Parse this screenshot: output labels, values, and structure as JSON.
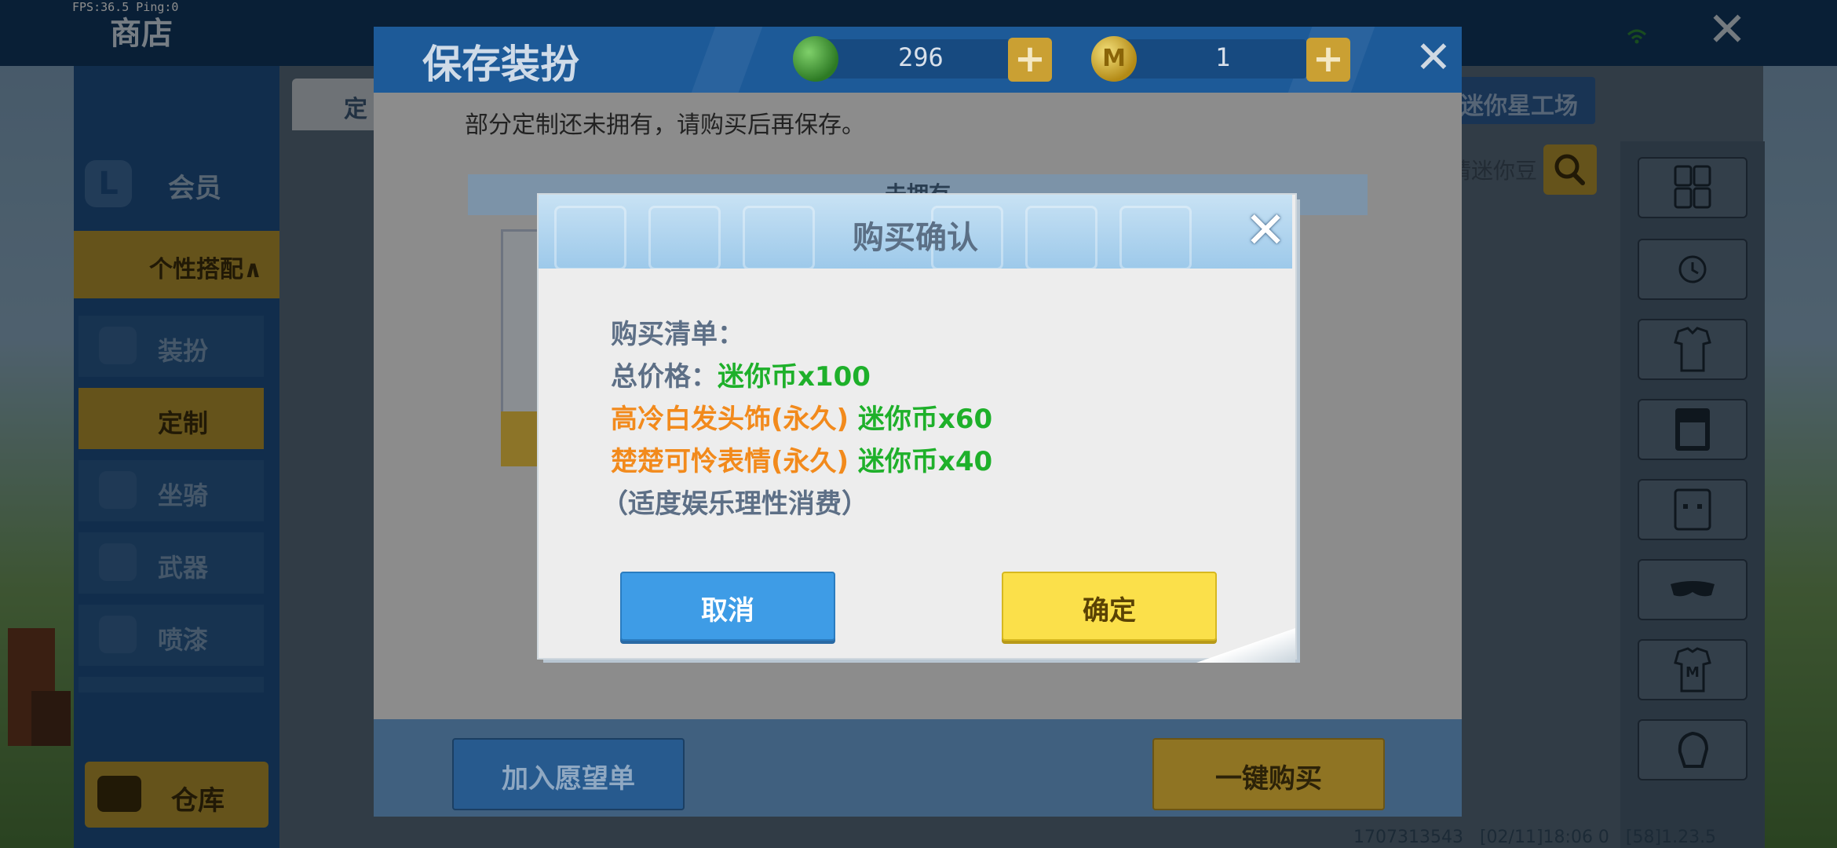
{
  "debug": {
    "fps_text": "FPS:36.5  Ping:0"
  },
  "shop": {
    "title": "商店",
    "close_glyph": "✕",
    "tab_left": "定",
    "tab_right": "迷你星工场",
    "search_hint": "请迷你豆"
  },
  "sidebar": {
    "vip": "会员",
    "group": "个性搭配∧",
    "items": [
      {
        "label": "装扮",
        "active": false
      },
      {
        "label": "定制",
        "active": true
      },
      {
        "label": "坐骑",
        "active": false
      },
      {
        "label": "武器",
        "active": false
      },
      {
        "label": "喷漆",
        "active": false
      }
    ],
    "warehouse": "仓库"
  },
  "save_dialog": {
    "title": "保存装扮",
    "gem_count": "296",
    "coin_count": "1",
    "plus_glyph": "+",
    "coin_glyph": "M",
    "close_glyph": "✕",
    "message": "部分定制还未拥有，请购买后再保存。",
    "unowned_header": "未拥有",
    "wishlist_button": "加入愿望单",
    "buy_all_button": "一键购买"
  },
  "confirm_dialog": {
    "title": "购买确认",
    "close_glyph": "✕",
    "list_label": "购买清单：",
    "total_label": "总价格：",
    "total_value": "迷你币x100",
    "items": [
      {
        "name": "高冷白发头饰(永久)",
        "price": "迷你币x60"
      },
      {
        "name": "楚楚可怜表情(永久)",
        "price": "迷你币x40"
      }
    ],
    "notice": "（适度娱乐理性消费）",
    "cancel_button": "取消",
    "ok_button": "确定"
  },
  "right_panel": {
    "icons": [
      "grid-icon",
      "history-icon",
      "outfit-icon",
      "hair-icon",
      "face-icon",
      "mask-icon",
      "m-shirt-icon",
      "glove-icon"
    ]
  },
  "status": {
    "uid": "1707313543",
    "datetime": "[02/11]18:06 0",
    "version": "[58]1.23.5"
  },
  "colors": {
    "shop_header": "#123a63",
    "save_header": "#1d5a98",
    "highlight_gold": "#b89832",
    "price_green": "#1eb02a",
    "item_orange": "#f28a1c",
    "cancel_blue": "#3e9ce6",
    "ok_yellow": "#fbe04a"
  }
}
